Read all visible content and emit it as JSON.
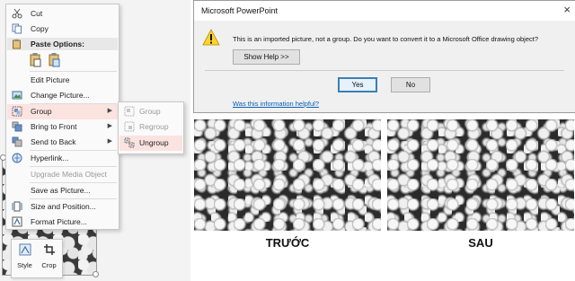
{
  "context_menu": {
    "items": [
      {
        "label": "Cut",
        "icon": "scissors-icon"
      },
      {
        "label": "Copy",
        "icon": "copy-icon"
      },
      {
        "label": "Paste Options:",
        "icon": "paste-icon"
      },
      {
        "label": "Edit Picture"
      },
      {
        "label": "Change Picture...",
        "icon": "change-picture-icon"
      },
      {
        "label": "Group",
        "icon": "group-icon",
        "submenu_arrow": "▶"
      },
      {
        "label": "Bring to Front",
        "icon": "bring-front-icon",
        "submenu_arrow": "▶"
      },
      {
        "label": "Send to Back",
        "icon": "send-back-icon",
        "submenu_arrow": "▶"
      },
      {
        "label": "Hyperlink...",
        "icon": "hyperlink-icon"
      },
      {
        "label": "Upgrade Media Object"
      },
      {
        "label": "Save as Picture..."
      },
      {
        "label": "Size and Position...",
        "icon": "size-position-icon"
      },
      {
        "label": "Format Picture...",
        "icon": "format-picture-icon"
      }
    ]
  },
  "group_submenu": {
    "items": [
      {
        "label": "Group",
        "disabled": true
      },
      {
        "label": "Regroup",
        "disabled": true
      },
      {
        "label": "Ungroup",
        "disabled": false
      }
    ]
  },
  "mini_toolbar": {
    "style_label": "Style",
    "crop_label": "Crop"
  },
  "dialog": {
    "title": "Microsoft PowerPoint",
    "close_glyph": "×",
    "message": "This is an imported picture, not a group. Do you want to convert it to a Microsoft Office drawing object?",
    "show_help_label": "Show Help >>",
    "yes_label": "Yes",
    "no_label": "No",
    "help_link": "Was this information helpful?"
  },
  "comparison": {
    "before_caption": "TRƯỚC",
    "after_caption": "SAU"
  },
  "colors": {
    "highlight": "#fbe3e0",
    "link": "#0a5fb4",
    "warning": "#ffd42a"
  }
}
